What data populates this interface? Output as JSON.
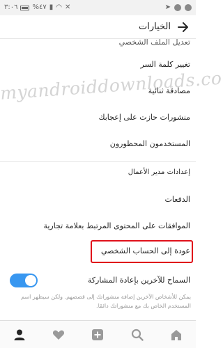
{
  "status_bar": {
    "time": "٣:٠٦",
    "battery": "%٤٧"
  },
  "header": {
    "title": "الخيارات"
  },
  "menu": {
    "items": [
      {
        "label": "تعديل الملف الشخصي"
      },
      {
        "label": "تغيير كلمة السر"
      },
      {
        "label": "مصادقة ثنائية"
      },
      {
        "label": "منشورات حازت على إعجابك"
      },
      {
        "label": "المستخدمون المحظورون"
      }
    ],
    "section_header": "إعدادات مدير الأعمال",
    "business_items": [
      {
        "label": "الدفعات"
      },
      {
        "label": "الموافقات على المحتوى المرتبط بعلامة تجارية"
      },
      {
        "label": "عودة إلى الحساب الشخصي"
      }
    ],
    "sharing_toggle": {
      "label": "السماح للآخرين بإعادة المشاركة",
      "enabled": true
    },
    "sharing_note": "يمكن للأشخاص الآخرين إضافة منشوراتك إلى قصصهم. ولكن سيظهر اسم المستخدم الخاص بك مع منشوراتك دائمًا."
  },
  "watermark": "myandroiddownloads.com",
  "colors": {
    "accent": "#3897f0",
    "highlight": "#e0101a"
  },
  "bottom_nav": {
    "items": [
      "home-icon",
      "search-icon",
      "add-icon",
      "heart-icon",
      "profile-icon"
    ]
  }
}
